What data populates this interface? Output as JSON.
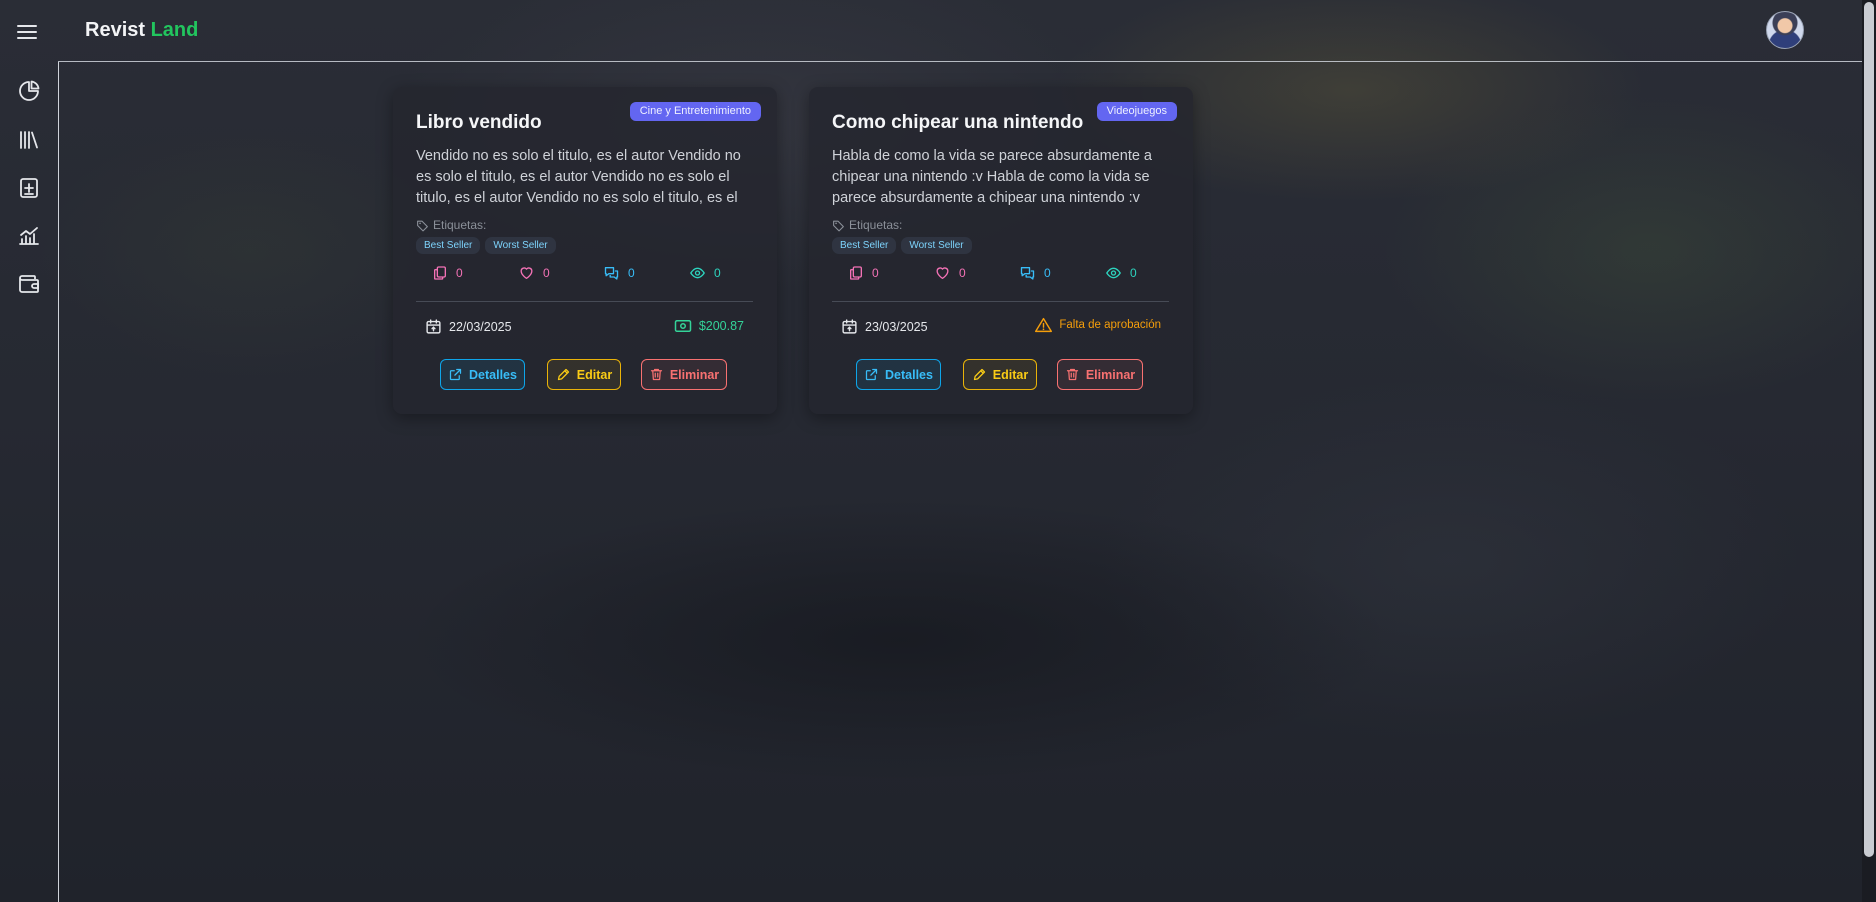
{
  "app": {
    "brand_primary": "Revist",
    "brand_accent": "Land",
    "accent_color": "#22c55e"
  },
  "sidebar": {
    "items": [
      {
        "icon": "pie-chart-icon"
      },
      {
        "icon": "library-icon"
      },
      {
        "icon": "add-document-icon"
      },
      {
        "icon": "trending-chart-icon"
      },
      {
        "icon": "wallet-icon"
      }
    ]
  },
  "cards": [
    {
      "category": "Cine y Entretenimiento",
      "title": "Libro vendido",
      "description": "Vendido no es solo el titulo, es el autor Vendido no es solo el titulo, es el autor Vendido no es solo el titulo, es el autor Vendido no es solo el titulo, es el",
      "tags_label": "Etiquetas:",
      "tags": [
        "Best Seller",
        "Worst Seller"
      ],
      "stats": {
        "copies": "0",
        "likes": "0",
        "comments": "0",
        "views": "0"
      },
      "date": "22/03/2025",
      "price": "$200.87",
      "buttons": {
        "details": "Detalles",
        "edit": "Editar",
        "delete": "Eliminar"
      }
    },
    {
      "category": "Videojuegos",
      "title": "Como chipear una nintendo",
      "description": "Habla de como la vida se parece absurdamente a chipear una nintendo :v Habla de como la vida se parece absurdamente a chipear una nintendo :v",
      "tags_label": "Etiquetas:",
      "tags": [
        "Best Seller",
        "Worst Seller"
      ],
      "stats": {
        "copies": "0",
        "likes": "0",
        "comments": "0",
        "views": "0"
      },
      "date": "23/03/2025",
      "status": "Falta de aprobación",
      "buttons": {
        "details": "Detalles",
        "edit": "Editar",
        "delete": "Eliminar"
      }
    }
  ],
  "colors": {
    "badge": "#6366f1",
    "copies": "#f472b6",
    "likes": "#f472b6",
    "comments": "#38bdf8",
    "views": "#2dd4bf",
    "price": "#34d399",
    "warning": "#f59e0b"
  }
}
